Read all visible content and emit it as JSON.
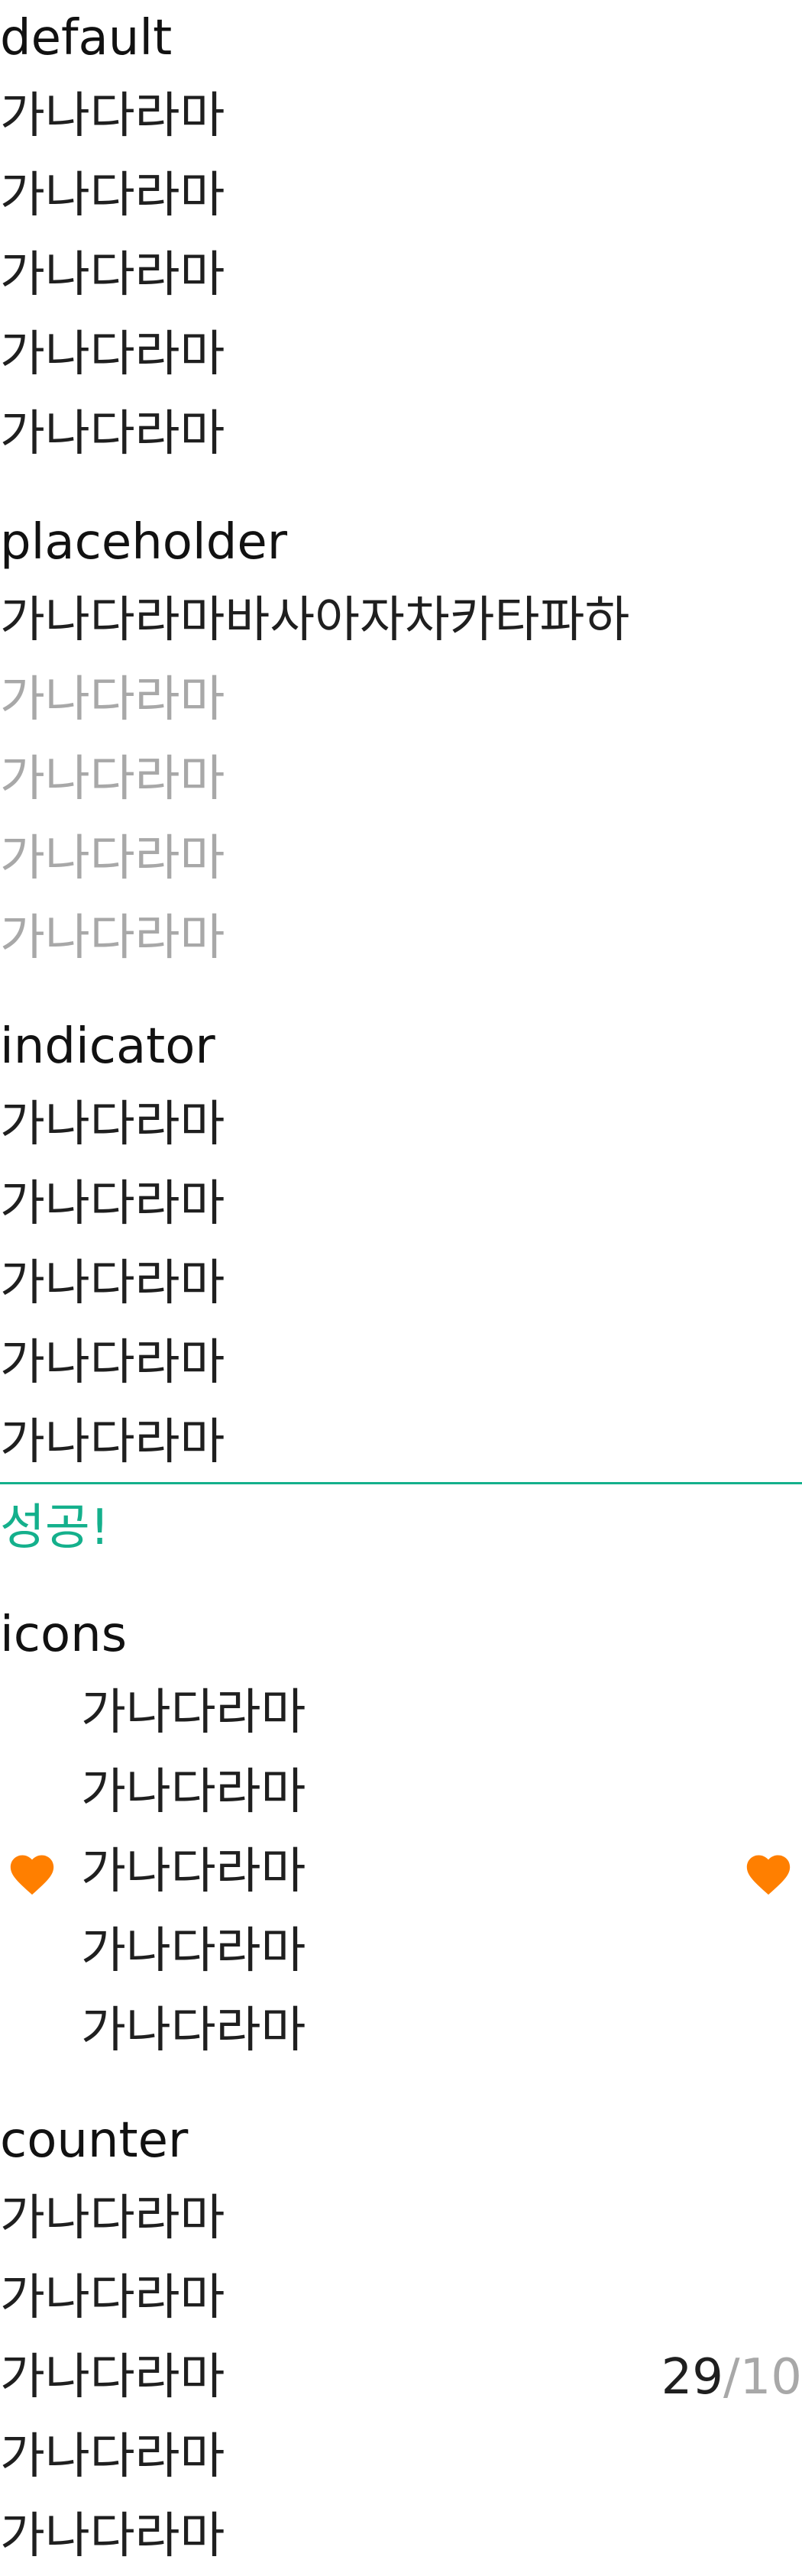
{
  "sections": {
    "default": {
      "title": "default",
      "lines": [
        "가나다라마",
        "가나다라마",
        "가나다라마",
        "가나다라마",
        "가나다라마"
      ]
    },
    "placeholder": {
      "title": "placeholder",
      "value": "가나다라마바사아자차카타파하",
      "placeholder_lines": [
        "가나다라마",
        "가나다라마",
        "가나다라마",
        "가나다라마"
      ]
    },
    "indicator": {
      "title": "indicator",
      "lines": [
        "가나다라마",
        "가나다라마",
        "가나다라마",
        "가나다라마",
        "가나다라마"
      ],
      "helper": "성공!",
      "indicator_color": "#14b08c"
    },
    "icons": {
      "title": "icons",
      "lines": [
        "가나다라마",
        "가나다라마",
        "가나다라마",
        "가나다라마",
        "가나다라마"
      ],
      "leading_icon": "heart-icon",
      "trailing_icon": "heart-icon",
      "icon_color": "#ff7f00"
    },
    "counter": {
      "title": "counter",
      "lines": [
        "가나다라마",
        "가나다라마",
        "가나다라마",
        "가나다라마",
        "가나다라마"
      ],
      "current": "29",
      "separator": "/",
      "max": "10"
    }
  }
}
